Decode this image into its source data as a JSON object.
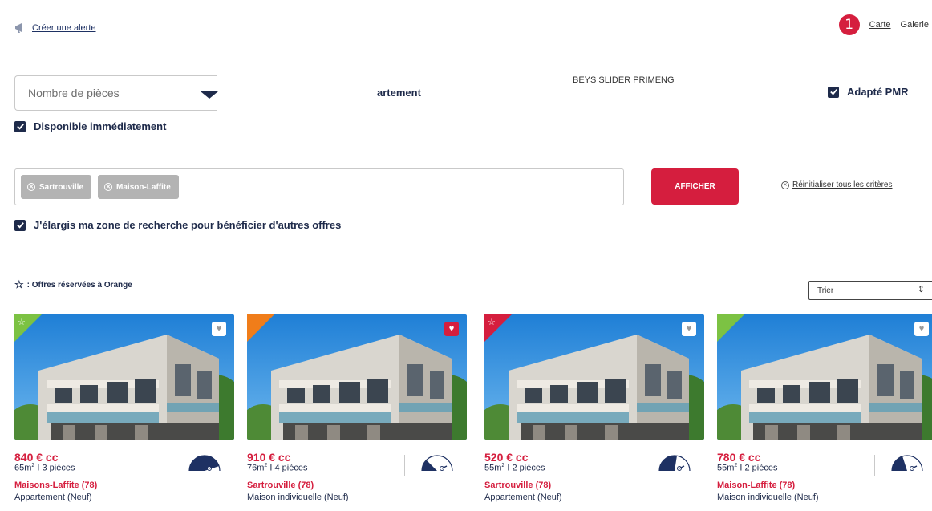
{
  "header": {
    "alert_label": "Créer une alerte",
    "step_badge": "1",
    "views": [
      "Carte",
      "Galerie"
    ]
  },
  "filters": {
    "rooms_placeholder": "Nombre de pièces",
    "type_label": "artement",
    "slider_label": "BEYS SLIDER PRIMENG",
    "pmr_label": "Adapté PMR",
    "available_label": "Disponible immédiatement",
    "locations": [
      "Sartrouville",
      "Maison-Laffite"
    ],
    "show_button": "AFFICHER",
    "reset_label": "Réinitialiser tous les critères",
    "widen_label": "J'élargis ma zone de recherche pour bénéficier d'autres offres"
  },
  "offers": {
    "note": ": Offres réservées à Orange",
    "sort_label": "Trier",
    "cards": [
      {
        "price": "840 € cc",
        "area": "65m",
        "rooms": "I 3 pièces",
        "city": "Maisons-Laffite (78)",
        "type": "Appartement (Neuf)",
        "corner_color": "#7cc243",
        "reserved": true,
        "favorite": false,
        "energy_level": 0.9
      },
      {
        "price": "910 € cc",
        "area": "76m",
        "rooms": "I 4 pièces",
        "city": "Sartrouville (78)",
        "type": "Maison individuelle (Neuf)",
        "corner_color": "#f07d1a",
        "reserved": false,
        "favorite": true,
        "energy_level": 0.25
      },
      {
        "price": "520 € cc",
        "area": "55m",
        "rooms": "I 2 pièces",
        "city": "Sartrouville (78)",
        "type": "Appartement (Neuf)",
        "corner_color": "#d51e3e",
        "reserved": true,
        "favorite": false,
        "energy_level": 0.55
      },
      {
        "price": "780 € cc",
        "area": "55m",
        "rooms": "I 2 pièces",
        "city": "Maison-Laffite (78)",
        "type": "Maison individuelle (Neuf)",
        "corner_color": "#7cc243",
        "reserved": false,
        "favorite": false,
        "energy_level": 0.4
      }
    ]
  },
  "colors": {
    "accent": "#d51e3e",
    "navy": "#1e2a4a",
    "chip": "#b3b3b3"
  }
}
